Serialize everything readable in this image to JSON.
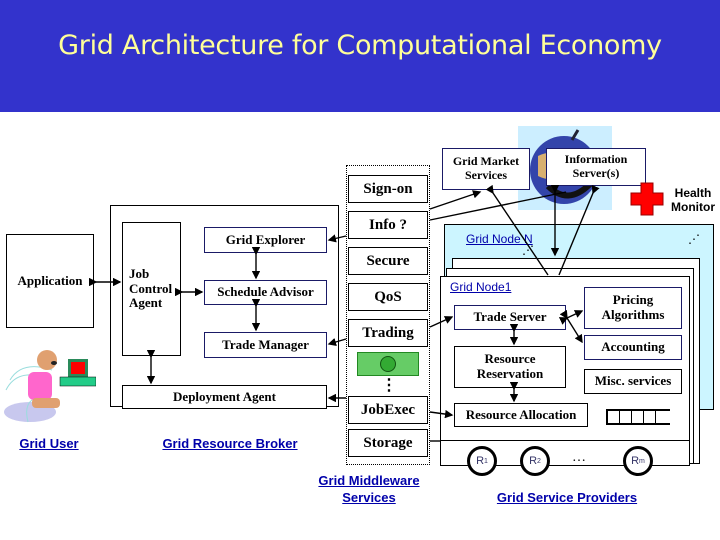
{
  "title": "Grid Architecture for Computational Economy",
  "colors": {
    "header_bg": "#3333cc",
    "title_text": "#ffff99",
    "node_bg": "#ccf5ff",
    "link_text": "#0000aa",
    "health_cross": "#ff0000"
  },
  "user": {
    "application": "Application",
    "label": "Grid User"
  },
  "broker": {
    "label": "Grid Resource Broker",
    "job_control_agent": "Job Control Agent",
    "grid_explorer": "Grid Explorer",
    "schedule_advisor": "Schedule Advisor",
    "trade_manager": "Trade Manager",
    "deployment_agent": "Deployment Agent"
  },
  "middleware": {
    "label": "Grid Middleware Services",
    "services": [
      "Sign-on",
      "Info ?",
      "Secure",
      "QoS",
      "Trading",
      "JobExec",
      "Storage"
    ],
    "ellipsis": "⋮"
  },
  "market": {
    "grid_market_services": "Grid Market Services",
    "information_servers": "Information Server(s)",
    "health_monitor": "Health Monitor"
  },
  "providers": {
    "label": "Grid Service Providers",
    "node_n": "Grid Node N",
    "node_1": "Grid Node1",
    "trade_server": "Trade Server",
    "pricing_algorithms": "Pricing Algorithms",
    "accounting": "Accounting",
    "resource_reservation": "Resource Reservation",
    "misc_services": "Misc. services",
    "resource_allocation": "Resource Allocation",
    "resources": [
      {
        "name": "R",
        "sub": "1"
      },
      {
        "name": "R",
        "sub": "2"
      },
      {
        "name": "R",
        "sub": "m"
      }
    ],
    "resource_ellipsis": "…",
    "node_ellipsis": "⋰"
  }
}
